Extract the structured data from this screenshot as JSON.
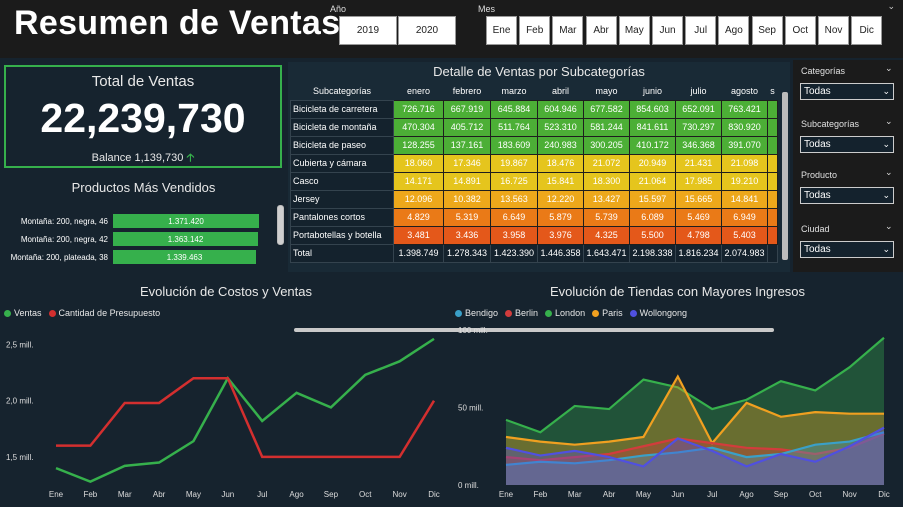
{
  "header": {
    "title": "Resumen de Ventas",
    "year_label": "Año",
    "years": [
      "2019",
      "2020"
    ],
    "month_label": "Mes",
    "months": [
      "Ene",
      "Feb",
      "Mar",
      "Abr",
      "May",
      "Jun",
      "Jul",
      "Ago",
      "Sep",
      "Oct",
      "Nov",
      "Dic"
    ]
  },
  "kpi": {
    "title": "Total de Ventas",
    "value": "22,239,730",
    "balance": "Balance 1,139,730",
    "balance_icon": "arrow-up-icon"
  },
  "top_products": {
    "title": "Productos Más Vendidos",
    "items": [
      {
        "label": "Montaña: 200, negra, 46",
        "value": "1.371.420",
        "amount": 1371420
      },
      {
        "label": "Montaña: 200, negra, 42",
        "value": "1.363.142",
        "amount": 1363142
      },
      {
        "label": "Montaña: 200, plateada, 38",
        "value": "1.339.463",
        "amount": 1339463
      }
    ]
  },
  "detail_table": {
    "title": "Detalle de Ventas por Subcategorías",
    "row_header": "Subcategorías",
    "columns": [
      "enero",
      "febrero",
      "marzo",
      "abril",
      "mayo",
      "junio",
      "julio",
      "agosto",
      "s"
    ],
    "rows": [
      {
        "name": "Bicicleta de carretera",
        "values": [
          "726.716",
          "667.919",
          "645.884",
          "604.946",
          "677.582",
          "854.603",
          "652.091",
          "763.421",
          ""
        ],
        "color": "#4caf36"
      },
      {
        "name": "Bicicleta de montaña",
        "values": [
          "470.304",
          "405.712",
          "511.764",
          "523.310",
          "581.244",
          "841.611",
          "730.297",
          "830.920",
          ""
        ],
        "color": "#4caf36"
      },
      {
        "name": "Bicicleta de paseo",
        "values": [
          "128.255",
          "137.161",
          "183.609",
          "240.983",
          "300.205",
          "410.172",
          "346.368",
          "391.070",
          ""
        ],
        "color": "#4caf36"
      },
      {
        "name": "Cubierta y cámara",
        "values": [
          "18.060",
          "17.346",
          "19.867",
          "18.476",
          "21.072",
          "20.949",
          "21.431",
          "21.098",
          ""
        ],
        "color": "#e5c51d"
      },
      {
        "name": "Casco",
        "values": [
          "14.171",
          "14.891",
          "16.725",
          "15.841",
          "18.300",
          "21.064",
          "17.985",
          "19.210",
          ""
        ],
        "color": "#e5c51d"
      },
      {
        "name": "Jersey",
        "values": [
          "12.096",
          "10.382",
          "13.563",
          "12.220",
          "13.427",
          "15.597",
          "15.665",
          "14.841",
          ""
        ],
        "color": "#eda81b"
      },
      {
        "name": "Pantalones cortos",
        "values": [
          "4.829",
          "5.319",
          "6.649",
          "5.879",
          "5.739",
          "6.089",
          "5.469",
          "6.949",
          ""
        ],
        "color": "#ea7a17"
      },
      {
        "name": "Portabotellas y botella",
        "values": [
          "3.481",
          "3.436",
          "3.958",
          "3.976",
          "4.325",
          "5.500",
          "4.798",
          "5.403",
          ""
        ],
        "color": "#e4581a"
      }
    ],
    "total": {
      "name": "Total",
      "values": [
        "1.398.749",
        "1.278.343",
        "1.423.390",
        "1.446.358",
        "1.643.471",
        "2.198.338",
        "1.816.234",
        "2.074.983",
        ""
      ]
    }
  },
  "filters": [
    {
      "label": "Categorías",
      "value": "Todas"
    },
    {
      "label": "Subcategorías",
      "value": "Todas"
    },
    {
      "label": "Producto",
      "value": "Todas"
    },
    {
      "label": "Ciudad",
      "value": "Todas"
    }
  ],
  "chart_data": [
    {
      "type": "line",
      "title": "Evolución de Costos y Ventas",
      "x": [
        "Ene",
        "Feb",
        "Mar",
        "Abr",
        "May",
        "Jun",
        "Jul",
        "Ago",
        "Sep",
        "Oct",
        "Nov",
        "Dic"
      ],
      "ylim": [
        1.25,
        2.7
      ],
      "yticks": [
        1.5,
        2.0,
        2.5
      ],
      "ytick_labels": [
        "1,5 mill.",
        "2,0 mill.",
        "2,5 mill."
      ],
      "series": [
        {
          "name": "Ventas",
          "color": "#36b04c",
          "values": [
            1.4,
            1.28,
            1.42,
            1.45,
            1.64,
            2.2,
            1.82,
            2.07,
            1.94,
            2.23,
            2.35,
            2.55
          ]
        },
        {
          "name": "Cantidad de Presupuesto",
          "color": "#d32f2f",
          "values": [
            1.6,
            1.6,
            1.98,
            1.98,
            2.2,
            2.2,
            1.5,
            1.5,
            1.5,
            1.5,
            1.5,
            2.0
          ]
        }
      ],
      "legend": "top-left",
      "grid": false
    },
    {
      "type": "area",
      "title": "Evolución de Tiendas con Mayores Ingresos",
      "x": [
        "Ene",
        "Feb",
        "Mar",
        "Abr",
        "May",
        "Jun",
        "Jul",
        "Ago",
        "Sep",
        "Oct",
        "Nov",
        "Dic"
      ],
      "ylim": [
        0,
        100
      ],
      "yticks": [
        0,
        50,
        100
      ],
      "ytick_labels": [
        "0 mill.",
        "50 mill.",
        "100 mill."
      ],
      "series": [
        {
          "name": "Bendigo",
          "color": "#3aa0c8",
          "values": [
            13,
            15,
            14,
            16,
            19,
            21,
            24,
            18,
            20,
            26,
            28,
            34
          ]
        },
        {
          "name": "Berlin",
          "color": "#d23c3c",
          "values": [
            18,
            16,
            18,
            20,
            25,
            30,
            27,
            24,
            23,
            20,
            24,
            33
          ]
        },
        {
          "name": "London",
          "color": "#36b04c",
          "values": [
            42,
            34,
            51,
            49,
            68,
            63,
            49,
            55,
            67,
            61,
            76,
            95
          ]
        },
        {
          "name": "Paris",
          "color": "#f0a020",
          "values": [
            31,
            28,
            26,
            28,
            31,
            70,
            27,
            53,
            44,
            47,
            46,
            46
          ]
        },
        {
          "name": "Wollongong",
          "color": "#5050e0",
          "values": [
            24,
            19,
            22,
            18,
            12,
            30,
            22,
            12,
            20,
            15,
            25,
            37
          ]
        }
      ],
      "legend": "top-left",
      "grid": false
    }
  ]
}
